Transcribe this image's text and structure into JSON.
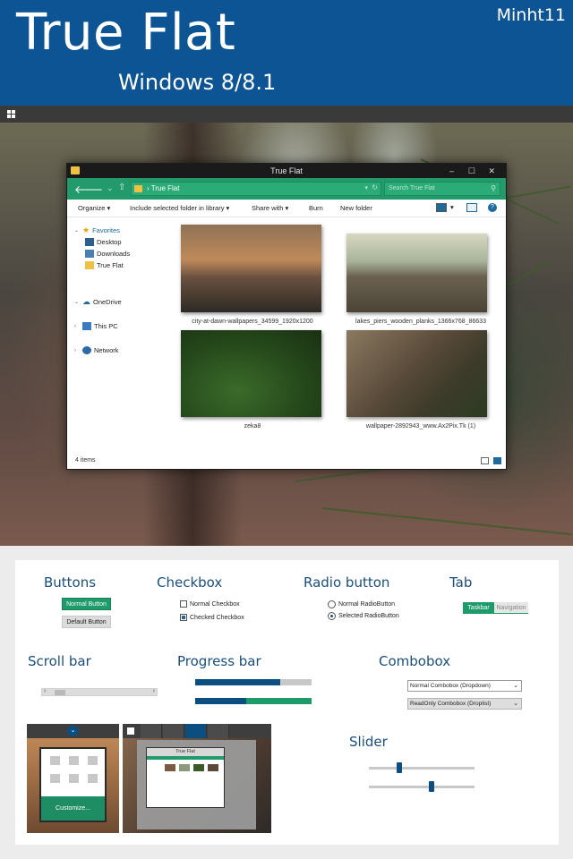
{
  "header": {
    "title": "True Flat",
    "subtitle": "Windows 8/8.1",
    "author": "Minht11"
  },
  "explorer": {
    "window_title": "True Flat",
    "window_controls": [
      "–",
      "☐",
      "✕"
    ],
    "address_path": "True Flat",
    "search_placeholder": "Search True Flat",
    "commands": {
      "organize": "Organize ▾",
      "include": "Include selected folder in library ▾",
      "share": "Share with ▾",
      "burn": "Burn",
      "new_folder": "New folder"
    },
    "nav": {
      "favorites": "Favorites",
      "desktop": "Desktop",
      "downloads": "Downloads",
      "trueflat": "True Flat",
      "onedrive": "OneDrive",
      "thispc": "This PC",
      "network": "Network"
    },
    "files": [
      {
        "name": "city-at-dawn-wallpapers_34599_1920x1200"
      },
      {
        "name": "lakes_piers_wooden_planks_1366x768_86633"
      },
      {
        "name": "zeka8"
      },
      {
        "name": "wallpaper-2892943_www.Ax2Pix.Tk (1)"
      }
    ],
    "status": "4 items"
  },
  "controls": {
    "buttons": {
      "title": "Buttons",
      "normal": "Normal Button",
      "default": "Default Button"
    },
    "checkbox": {
      "title": "Checkbox",
      "normal": "Normal Checkbox",
      "checked": "Checked Checkbox"
    },
    "radio": {
      "title": "Radio button",
      "normal": "Normal RadioButton",
      "selected": "Selected RadioButton"
    },
    "tab": {
      "title": "Tab",
      "active": "Taskbar",
      "inactive": "Navigation"
    },
    "scrollbar": {
      "title": "Scroll bar",
      "position": 0.05
    },
    "progress": {
      "title": "Progress bar",
      "bar1": 0.73,
      "bar2_blue": 0.44
    },
    "combobox": {
      "title": "Combobox",
      "normal": "Normal Combobox (Dropdown)",
      "readonly": "ReadOnly Combobox (Droplist)"
    },
    "slider": {
      "title": "Slider",
      "slider1": 0.28,
      "slider2": 0.6
    },
    "start_preview": {
      "customize": "Customize..."
    },
    "preview_window_title": "True Flat"
  },
  "colors": {
    "header_blue": "#0d5495",
    "accent_green": "#1e9b6a",
    "dark_blue": "#0d4e80"
  }
}
